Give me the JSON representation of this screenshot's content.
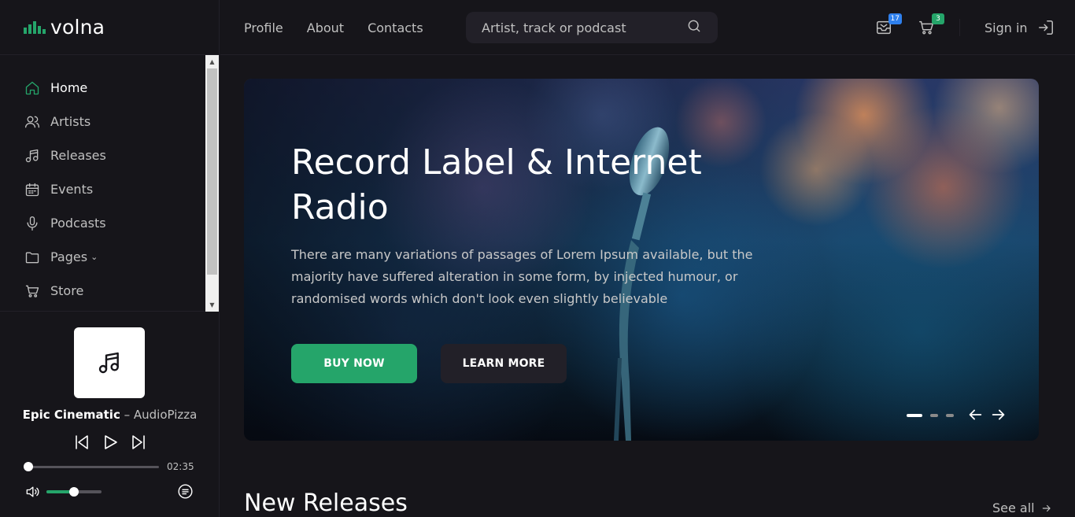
{
  "brand": {
    "name": "volna",
    "accent": "#25a56a"
  },
  "sidebar": {
    "items": [
      {
        "label": "Home",
        "icon": "home-icon",
        "active": true
      },
      {
        "label": "Artists",
        "icon": "users-icon"
      },
      {
        "label": "Releases",
        "icon": "music-note-icon"
      },
      {
        "label": "Events",
        "icon": "calendar-icon"
      },
      {
        "label": "Podcasts",
        "icon": "microphone-icon"
      },
      {
        "label": "Pages",
        "icon": "folder-icon",
        "caret": "⌄"
      },
      {
        "label": "Store",
        "icon": "cart-icon"
      }
    ]
  },
  "player": {
    "track_title": "Epic Cinematic",
    "separator": " – ",
    "artist": "AudioPizza",
    "duration": "02:35",
    "progress": 0.03,
    "volume": 0.5
  },
  "header": {
    "nav": [
      "Profile",
      "About",
      "Contacts"
    ],
    "search_placeholder": "Artist, track or podcast",
    "inbox_badge": "17",
    "cart_badge": "3",
    "signin_label": "Sign in"
  },
  "hero": {
    "title": "Record Label & Internet Radio",
    "text": "There are many variations of passages of Lorem Ipsum available, but the majority have suffered alteration in some form, by injected humour, or randomised words which don't look even slightly believable",
    "buy_label": "BUY NOW",
    "learn_label": "LEARN MORE",
    "slides_count": 3,
    "active_slide": 1
  },
  "section": {
    "title": "New Releases",
    "see_all": "See all"
  }
}
